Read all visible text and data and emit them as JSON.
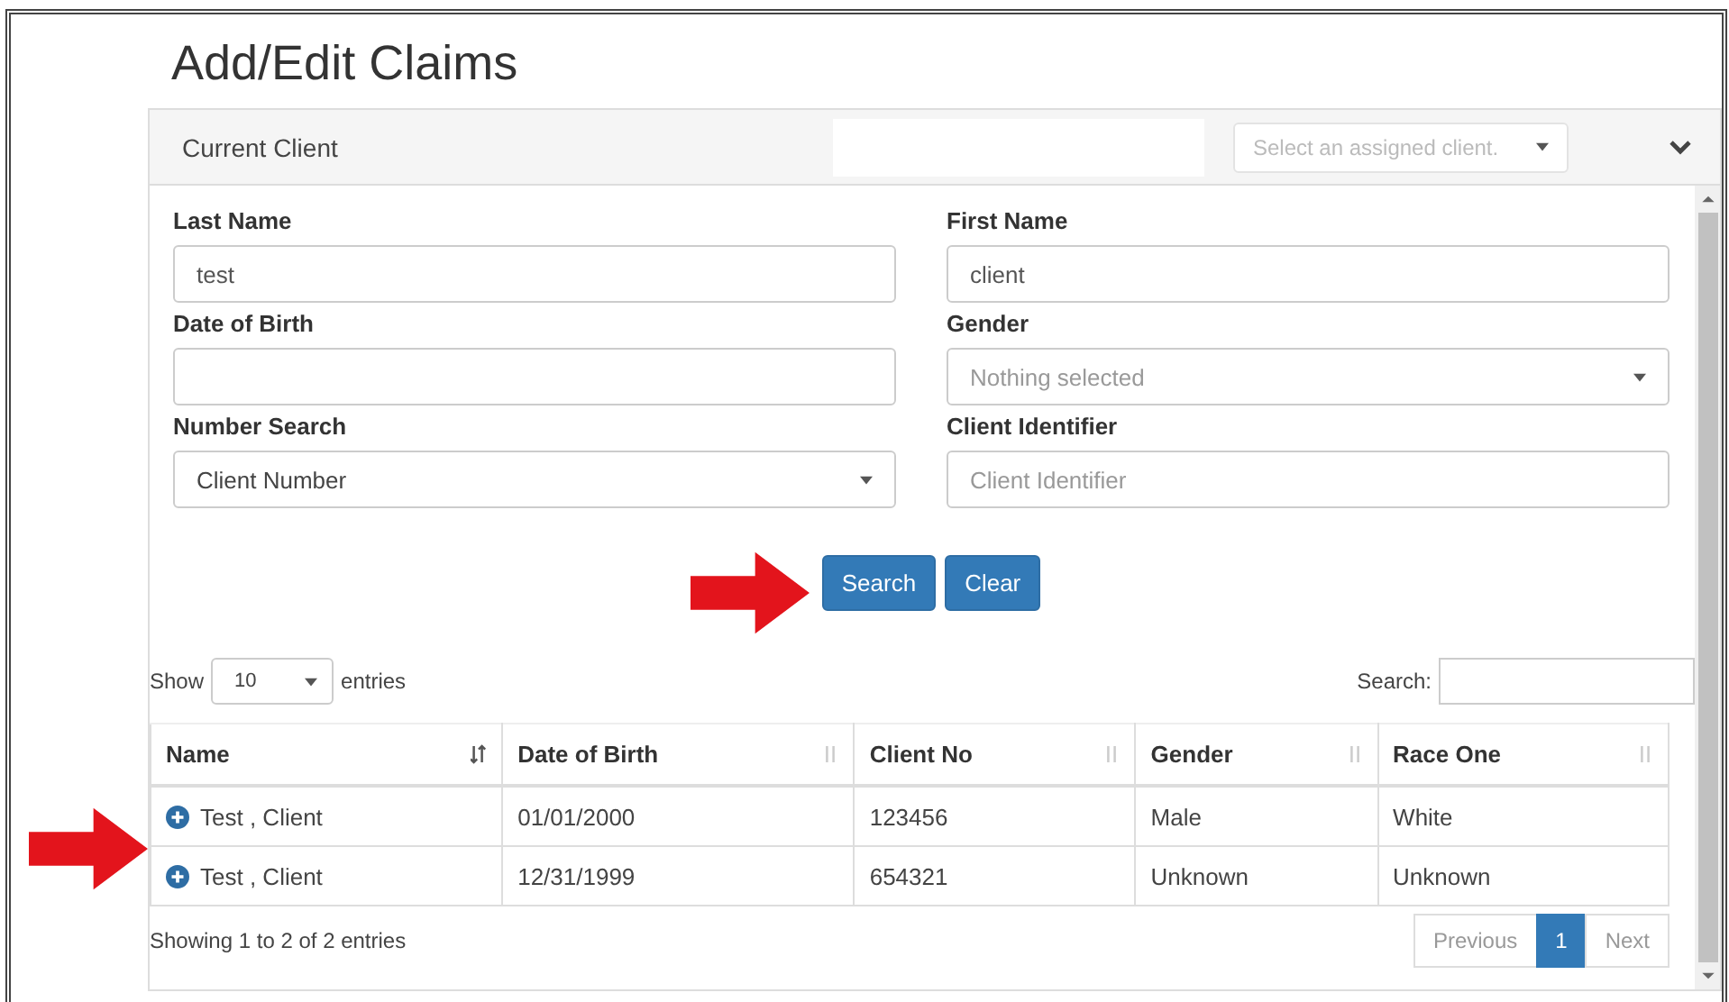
{
  "page": {
    "title": "Add/Edit Claims"
  },
  "current_client": {
    "label": "Current Client",
    "select_placeholder": "Select an assigned client."
  },
  "form": {
    "fields": [
      {
        "label": "Last Name",
        "kind": "text",
        "value": "test"
      },
      {
        "label": "First Name",
        "kind": "text",
        "value": "client"
      },
      {
        "label": "Date of Birth",
        "kind": "text"
      },
      {
        "label": "Gender",
        "kind": "select",
        "placeholder": "Nothing selected"
      },
      {
        "label": "Number Search",
        "kind": "select",
        "value": "Client Number"
      },
      {
        "label": "Client Identifier",
        "kind": "text",
        "placeholder": "Client Identifier"
      }
    ],
    "buttons": [
      "Search",
      "Clear"
    ]
  },
  "table_controls": {
    "show_label": "Show",
    "page_size": "10",
    "entries_label": "entries",
    "search_label": "Search:"
  },
  "table": {
    "columns": [
      {
        "label": "Name",
        "sorted": true
      },
      {
        "label": "Date of Birth",
        "sorted": false
      },
      {
        "label": "Client No",
        "sorted": false
      },
      {
        "label": "Gender",
        "sorted": false
      },
      {
        "label": "Race One",
        "sorted": false
      }
    ],
    "rows": [
      [
        "Test , Client",
        "01/01/2000",
        "123456",
        "Male",
        "White"
      ],
      [
        "Test , Client",
        "12/31/1999",
        "654321",
        "Unknown",
        "Unknown"
      ]
    ]
  },
  "footer": {
    "info": "Showing 1 to 2 of 2 entries",
    "pagination": [
      {
        "label": "Previous",
        "disabled": true,
        "selected": false
      },
      {
        "label": "1",
        "disabled": false,
        "selected": true
      },
      {
        "label": "Next",
        "disabled": true,
        "selected": false
      }
    ]
  }
}
